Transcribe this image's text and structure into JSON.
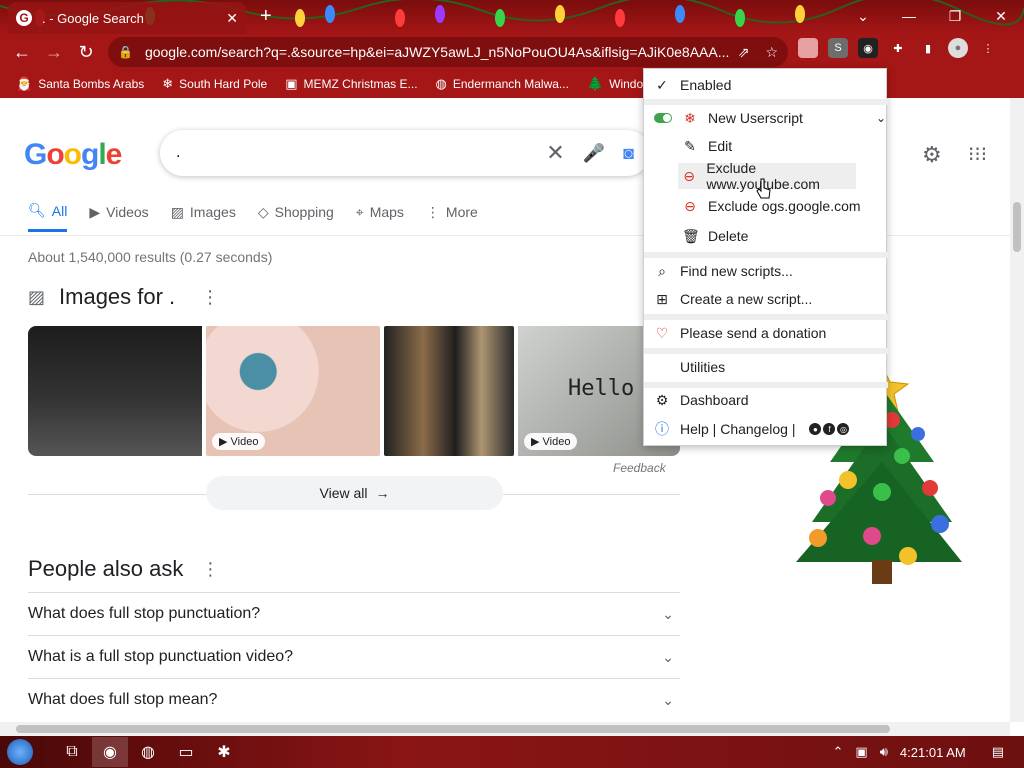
{
  "browser": {
    "tab_title": ". - Google Search",
    "url": "google.com/search?q=.&source=hp&ei=aJWZY5awLJ_n5NoPouOU4As&iflsig=AJiK0e8AAA...",
    "bookmarks": [
      {
        "label": "Santa Bombs Arabs",
        "icon": "santa-icon"
      },
      {
        "label": "South Hard Pole",
        "icon": "snowflake-icon"
      },
      {
        "label": "MEMZ Christmas E...",
        "icon": "memz-icon"
      },
      {
        "label": "Endermanch Malwa...",
        "icon": "enderman-icon"
      },
      {
        "label": "Windo",
        "icon": "tree-icon"
      }
    ]
  },
  "google": {
    "logo": "Google",
    "query": ".",
    "tabs": [
      {
        "label": "All",
        "active": true
      },
      {
        "label": "Videos"
      },
      {
        "label": "Images"
      },
      {
        "label": "Shopping"
      },
      {
        "label": "Maps"
      },
      {
        "label": "More"
      }
    ],
    "result_stats": "About 1,540,000 results (0.27 seconds)",
    "images_heading": "Images for .",
    "video_badge": "Video",
    "hello_text": "Hello",
    "feedback": "Feedback",
    "view_all": "View all",
    "paa_heading": "People also ask",
    "questions": [
      "What does full stop punctuation?",
      "What is a full stop punctuation video?",
      "What does full stop mean?"
    ]
  },
  "menu": {
    "enabled": "Enabled",
    "script_name": "New Userscript",
    "edit": "Edit",
    "exclude_youtube": "Exclude www.youtube.com",
    "exclude_ogs": "Exclude ogs.google.com",
    "delete": "Delete",
    "find": "Find new scripts...",
    "create": "Create a new script...",
    "donate": "Please send a donation",
    "utilities": "Utilities",
    "dashboard": "Dashboard",
    "help": "Help | Changelog |"
  },
  "taskbar": {
    "clock": "4:21:01 AM"
  },
  "colors": {
    "theme_red": "#a51616",
    "google_blue": "#1a73e8",
    "toggle_green": "#3fa34d"
  }
}
